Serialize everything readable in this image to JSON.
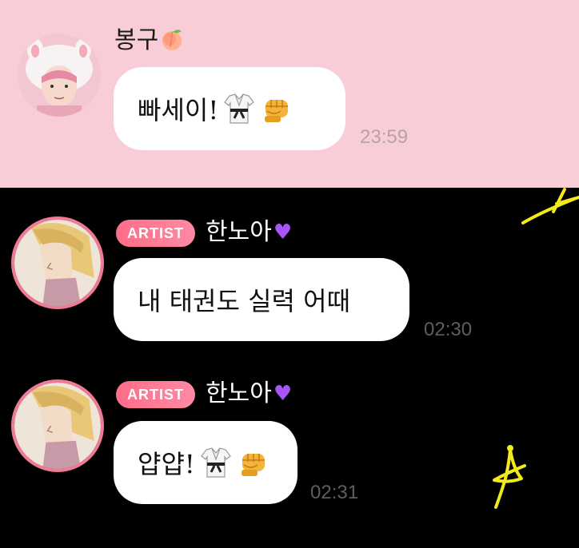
{
  "messages": [
    {
      "sender": "봉구",
      "text": "빠세이!",
      "time": "23:59",
      "icons": [
        "dobok-icon",
        "fist-icon"
      ]
    },
    {
      "badge": "ARTIST",
      "sender": "한노아",
      "text": "내 태권도 실력 어때",
      "time": "02:30",
      "icons": []
    },
    {
      "badge": "ARTIST",
      "sender": "한노아",
      "text": "얍얍!",
      "time": "02:31",
      "icons": [
        "dobok-icon",
        "fist-icon"
      ]
    }
  ],
  "colors": {
    "top_background": "#f8cdd7",
    "bottom_background": "#000000",
    "badge": "#ff7a95",
    "bubble": "#ffffff",
    "heart": "#a855f7",
    "doodle": "#f2ea1a"
  },
  "icons": [
    "peach-icon",
    "purple-heart-icon",
    "dobok-icon",
    "fist-icon"
  ]
}
